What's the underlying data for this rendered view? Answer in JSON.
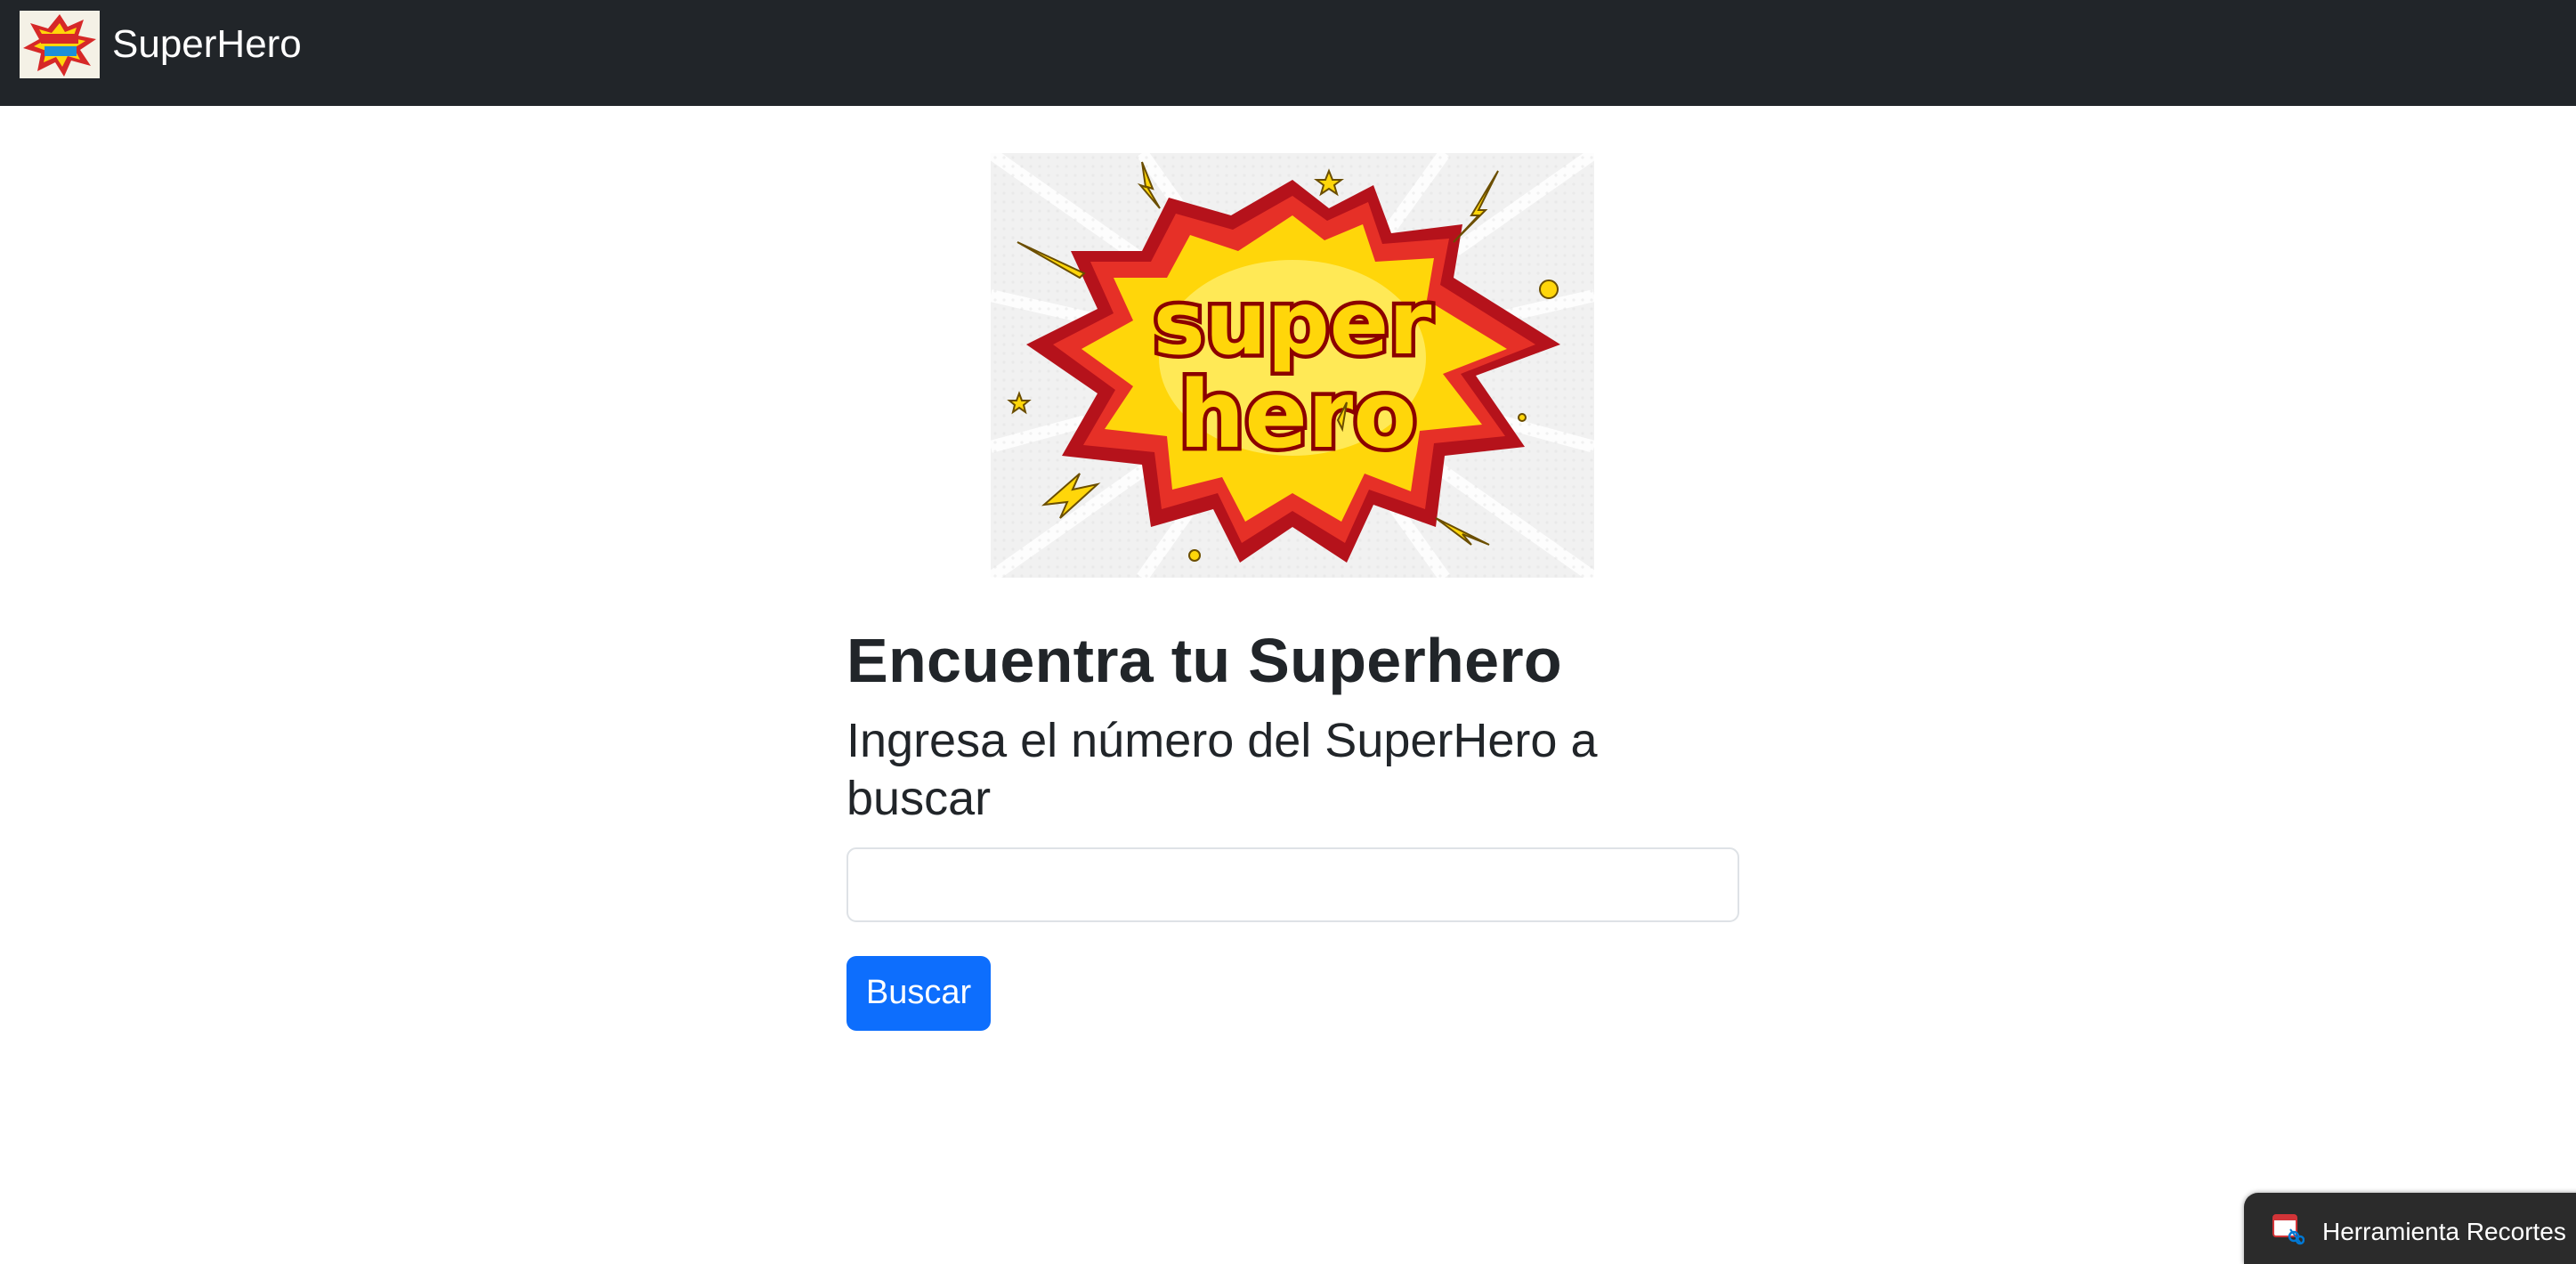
{
  "navbar": {
    "brand_text": "SuperHero",
    "logo_icon": "superhero-logo-icon",
    "background_color": "#212529"
  },
  "hero_image": {
    "icon": "superhero-comic-burst-image",
    "word_top": "super",
    "word_bottom": "hero"
  },
  "main": {
    "title": "Encuentra tu Superhero",
    "subtitle": "Ingresa el número del SuperHero a buscar",
    "input_value": "",
    "input_placeholder": "",
    "button_label": "Buscar",
    "button_color": "#0d6efd"
  },
  "snipping_toast": {
    "label": "Herramienta Recortes",
    "icon": "snipping-tool-icon"
  }
}
